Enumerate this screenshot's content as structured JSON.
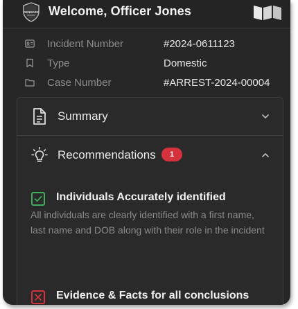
{
  "header": {
    "badge_text": "GENMARK",
    "title": "Welcome, Officer Jones"
  },
  "info": {
    "incident": {
      "label": "Incident Number",
      "value": "#2024-0611123",
      "icon": "id-card-icon"
    },
    "type": {
      "label": "Type",
      "value": "Domestic",
      "icon": "bookmark-icon"
    },
    "case": {
      "label": "Case Number",
      "value": "#ARREST-2024-00004",
      "icon": "folder-icon"
    }
  },
  "accordion": {
    "summary": {
      "label": "Summary",
      "icon": "document-icon",
      "expanded": false
    },
    "recommendations": {
      "label": "Recommendations",
      "icon": "lightbulb-icon",
      "count": "1",
      "expanded": true
    }
  },
  "recommendations": [
    {
      "status": "passed",
      "title": "Individuals Accurately identified",
      "description": "All individuals are clearly identified with a first name, last name and DOB along with their role in the incident"
    },
    {
      "status": "failed",
      "title": "Evidence & Facts for all conclusions",
      "description": ""
    }
  ],
  "colors": {
    "background": "#272727",
    "success": "#3fae5a",
    "error": "#d6323d",
    "badge": "#d6323d"
  }
}
